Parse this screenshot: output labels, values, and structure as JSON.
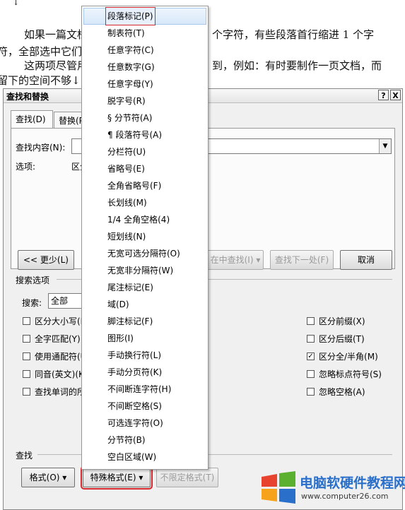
{
  "document": {
    "lines": [
      "↓",
      "如果一篇文档",
      "个字符，有些段落首行缩进 1 个字",
      "符，全部选中它们",
      "这两项尽管用",
      "到，例如：有时要制作一页文档，而",
      "留下的空间不够↓"
    ]
  },
  "dialog": {
    "title": "查找和替换",
    "help_label": "?",
    "close_label": "X",
    "tabs": [
      "查找(D)",
      "替换(P)"
    ],
    "find_label": "查找内容(N):",
    "options_label": "选项:",
    "options_value": "区分",
    "less_button": "<< 更少(L)",
    "find_in_button": "在中查找(I) ▾",
    "find_next_button": "查找下一处(F)",
    "cancel_button": "取消",
    "search_options_label": "搜索选项",
    "search_label": "搜索:",
    "search_value": "全部",
    "left_options": [
      {
        "label": "区分大小写(H)",
        "checked": false
      },
      {
        "label": "全字匹配(Y)",
        "checked": false
      },
      {
        "label": "使用通配符(U)",
        "checked": false
      },
      {
        "label": "同音(英文)(K)",
        "checked": false
      },
      {
        "label": "查找单词的所",
        "checked": false
      }
    ],
    "right_options": [
      {
        "label": "区分前缀(X)",
        "checked": false
      },
      {
        "label": "区分后缀(T)",
        "checked": false
      },
      {
        "label": "区分全/半角(M)",
        "checked": true
      },
      {
        "label": "忽略标点符号(S)",
        "checked": false
      },
      {
        "label": "忽略空格(A)",
        "checked": false
      }
    ],
    "find_section_label": "查找",
    "format_button": "格式(O) ▾",
    "special_button": "特殊格式(E) ▾",
    "no_format_button": "不限定格式(T)"
  },
  "special_menu": {
    "items": [
      "段落标记(P)",
      "制表符(T)",
      "任意字符(C)",
      "任意数字(G)",
      "任意字母(Y)",
      "脱字号(R)",
      "§ 分节符(A)",
      "¶ 段落符号(A)",
      "分栏符(U)",
      "省略号(E)",
      "全角省略号(F)",
      "长划线(M)",
      "1/4 全角空格(4)",
      "短划线(N)",
      "无宽可选分隔符(O)",
      "无宽非分隔符(W)",
      "尾注标记(E)",
      "域(D)",
      "脚注标记(F)",
      "图形(I)",
      "手动换行符(L)",
      "手动分页符(K)",
      "不间断连字符(H)",
      "不间断空格(S)",
      "可选连字符(O)",
      "分节符(B)",
      "空白区域(W)"
    ]
  },
  "watermark": {
    "name": "电脑软硬件教程网",
    "url": "www.computer26.com",
    "colors": {
      "red": "#e8432f",
      "orange": "#f7a21b",
      "blue": "#2a6fc9",
      "green": "#5bb030"
    }
  }
}
